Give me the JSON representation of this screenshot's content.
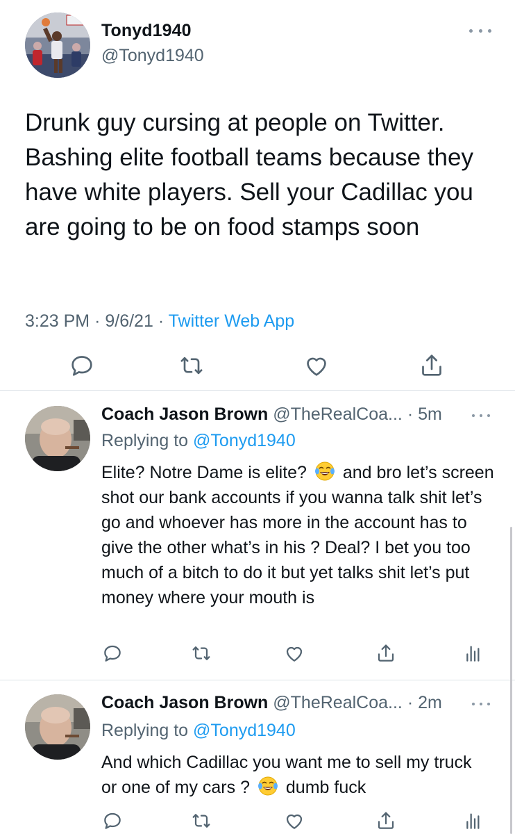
{
  "main_tweet": {
    "display_name": "Tonyd1940",
    "handle": "@Tonyd1940",
    "text": "Drunk guy cursing at people on Twitter. Bashing elite football teams because they have white players. Sell your Cadillac you are going to be on food stamps soon",
    "time": "3:23 PM",
    "date": "9/6/21",
    "separator": "·",
    "source": "Twitter Web App",
    "actions": [
      "reply-icon",
      "retweet-icon",
      "like-icon",
      "share-icon"
    ]
  },
  "replies": [
    {
      "display_name": "Coach Jason Brown",
      "handle": "@TheRealCoa...",
      "time": "· 5m",
      "replying_label": "Replying to",
      "replying_to": "@Tonyd1940",
      "text_before_emoji": "Elite? Notre Dame is elite?",
      "emoji": "face-with-tears-of-joy",
      "text_after_emoji": "and bro let’s screen shot our bank accounts if you wanna talk shit let’s go and whoever has more in the account has to give the other what’s in his ? Deal? I bet you too much of a bitch to do it but yet talks shit let’s put money where your mouth is",
      "actions": [
        "reply-icon",
        "retweet-icon",
        "like-icon",
        "share-icon",
        "analytics-icon"
      ]
    },
    {
      "display_name": "Coach Jason Brown",
      "handle": "@TheRealCoa...",
      "time": "· 2m",
      "replying_label": "Replying to",
      "replying_to": "@Tonyd1940",
      "text_before_emoji": "And which Cadillac you want me to sell my truck or one of my cars ?",
      "emoji": "face-with-tears-of-joy",
      "text_after_emoji": "dumb fuck",
      "actions": [
        "reply-icon",
        "retweet-icon",
        "like-icon",
        "share-icon",
        "analytics-icon"
      ]
    }
  ],
  "colors": {
    "text": "#0f1419",
    "secondary": "#536471",
    "link": "#1d9bf0",
    "divider": "#dde3e8",
    "icon": "#536471"
  }
}
